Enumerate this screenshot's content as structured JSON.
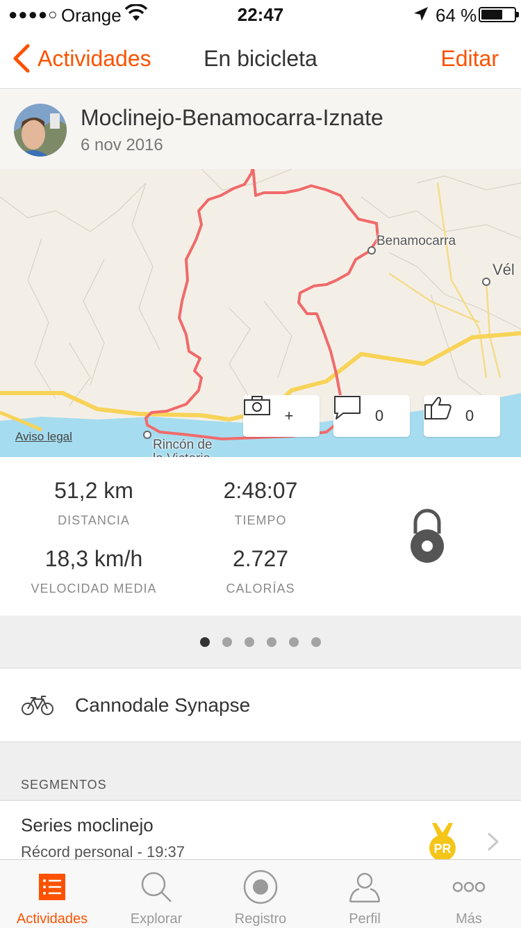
{
  "status_bar": {
    "carrier": "Orange",
    "signal": "●●●●○",
    "time": "22:47",
    "battery": "64 %"
  },
  "nav": {
    "back_label": "Actividades",
    "title": "En bicicleta",
    "edit_label": "Editar"
  },
  "activity": {
    "title": "Moclinejo-Benamocarra-Iznate",
    "date": "6 nov 2016"
  },
  "map": {
    "labels": {
      "benamocarra": "Benamocarra",
      "velez": "Vél",
      "rincon": "Rincón de",
      "rincon_2": "la Victoria"
    },
    "legal": "Aviso legal",
    "photo_add": "+",
    "comments": "0",
    "kudos": "0"
  },
  "stats": {
    "distance": {
      "value": "51,2 km",
      "label": "DISTANCIA"
    },
    "time": {
      "value": "2:48:07",
      "label": "TIEMPO"
    },
    "avg_speed": {
      "value": "18,3 km/h",
      "label": "VELOCIDAD MEDIA"
    },
    "calories": {
      "value": "2.727",
      "label": "CALORÍAS"
    }
  },
  "pager": {
    "pages": 6,
    "active": 0
  },
  "bike": {
    "name": "Cannodale Synapse"
  },
  "segments": {
    "header": "SEGMENTOS",
    "items": [
      {
        "name": "Series moclinejo",
        "detail": "Récord personal - 19:37",
        "badge": "PR"
      }
    ]
  },
  "tabs": [
    {
      "label": "Actividades",
      "icon": "activities-list-icon",
      "active": true
    },
    {
      "label": "Explorar",
      "icon": "search-icon",
      "active": false
    },
    {
      "label": "Registro",
      "icon": "record-icon",
      "active": false
    },
    {
      "label": "Perfil",
      "icon": "profile-icon",
      "active": false
    },
    {
      "label": "Más",
      "icon": "more-icon",
      "active": false
    }
  ],
  "colors": {
    "accent": "#fc5200",
    "route": "#f06a6a",
    "road": "#f7d358",
    "sea": "#a6dcef",
    "pr_gold": "#f5c518"
  }
}
